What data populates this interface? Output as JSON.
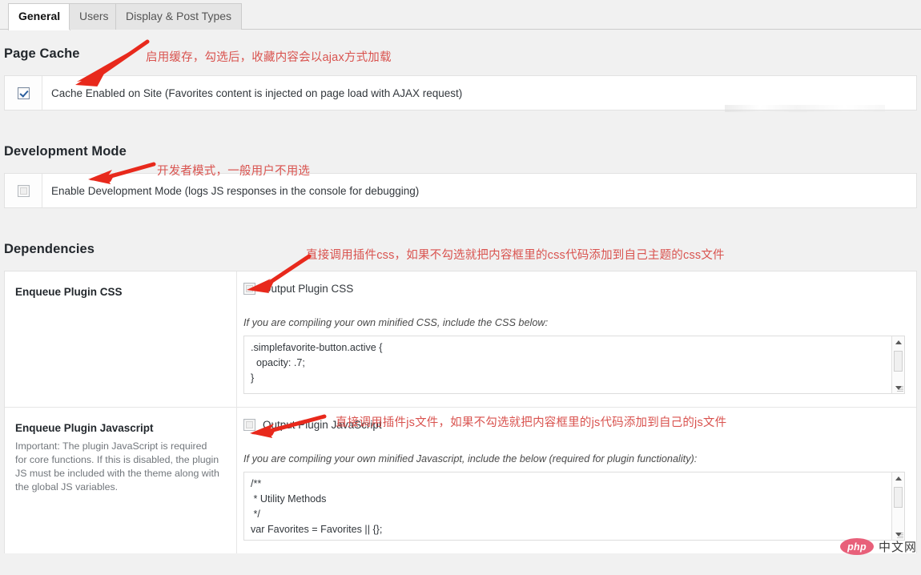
{
  "tabs": [
    {
      "label": "General",
      "active": true
    },
    {
      "label": "Users",
      "active": false
    },
    {
      "label": "Display & Post Types",
      "active": false
    }
  ],
  "sections": {
    "page_cache": {
      "title": "Page Cache",
      "checkbox_label": "Cache Enabled on Site (Favorites content is injected on page load with AJAX request)",
      "checked": "checked"
    },
    "development_mode": {
      "title": "Development Mode",
      "checkbox_label": "Enable Development Mode (logs JS responses in the console for debugging)",
      "checked": "unchecked"
    },
    "dependencies": {
      "title": "Dependencies",
      "rows": [
        {
          "name": "Enqueue Plugin CSS",
          "description": "",
          "checkbox_label": "Output Plugin CSS",
          "checked": "unchecked",
          "hint": "If you are compiling your own minified CSS, include the CSS below:",
          "code": ".simplefavorite-button.active {\n  opacity: .7;\n}"
        },
        {
          "name": "Enqueue Plugin Javascript",
          "description": "Important: The plugin JavaScript is required for core functions. If this is disabled, the plugin JS must be included with the theme along with the global JS variables.",
          "checkbox_label": "Output Plugin JavaScript",
          "checked": "unchecked",
          "hint": "If you are compiling your own minified Javascript, include the below (required for plugin functionality):",
          "code": "/**\n * Utility Methods\n */\nvar Favorites = Favorites || {};"
        }
      ]
    }
  },
  "annotations": [
    {
      "text": "启用缓存，勾选后，收藏内容会以ajax方式加载"
    },
    {
      "text": "开发者模式，一般用户不用选"
    },
    {
      "text": "直接调用插件css，如果不勾选就把内容框里的css代码添加到自己主题的css文件"
    },
    {
      "text": "直接调用插件js文件，如果不勾选就把内容框里的js代码添加到自己的js文件"
    }
  ],
  "watermark": {
    "logo_text": "php",
    "site_text": "中文网"
  },
  "colors": {
    "annotation_red": "#d9534f",
    "arrow_red": "#e8291c",
    "accent_blue": "#2b5f9e"
  }
}
